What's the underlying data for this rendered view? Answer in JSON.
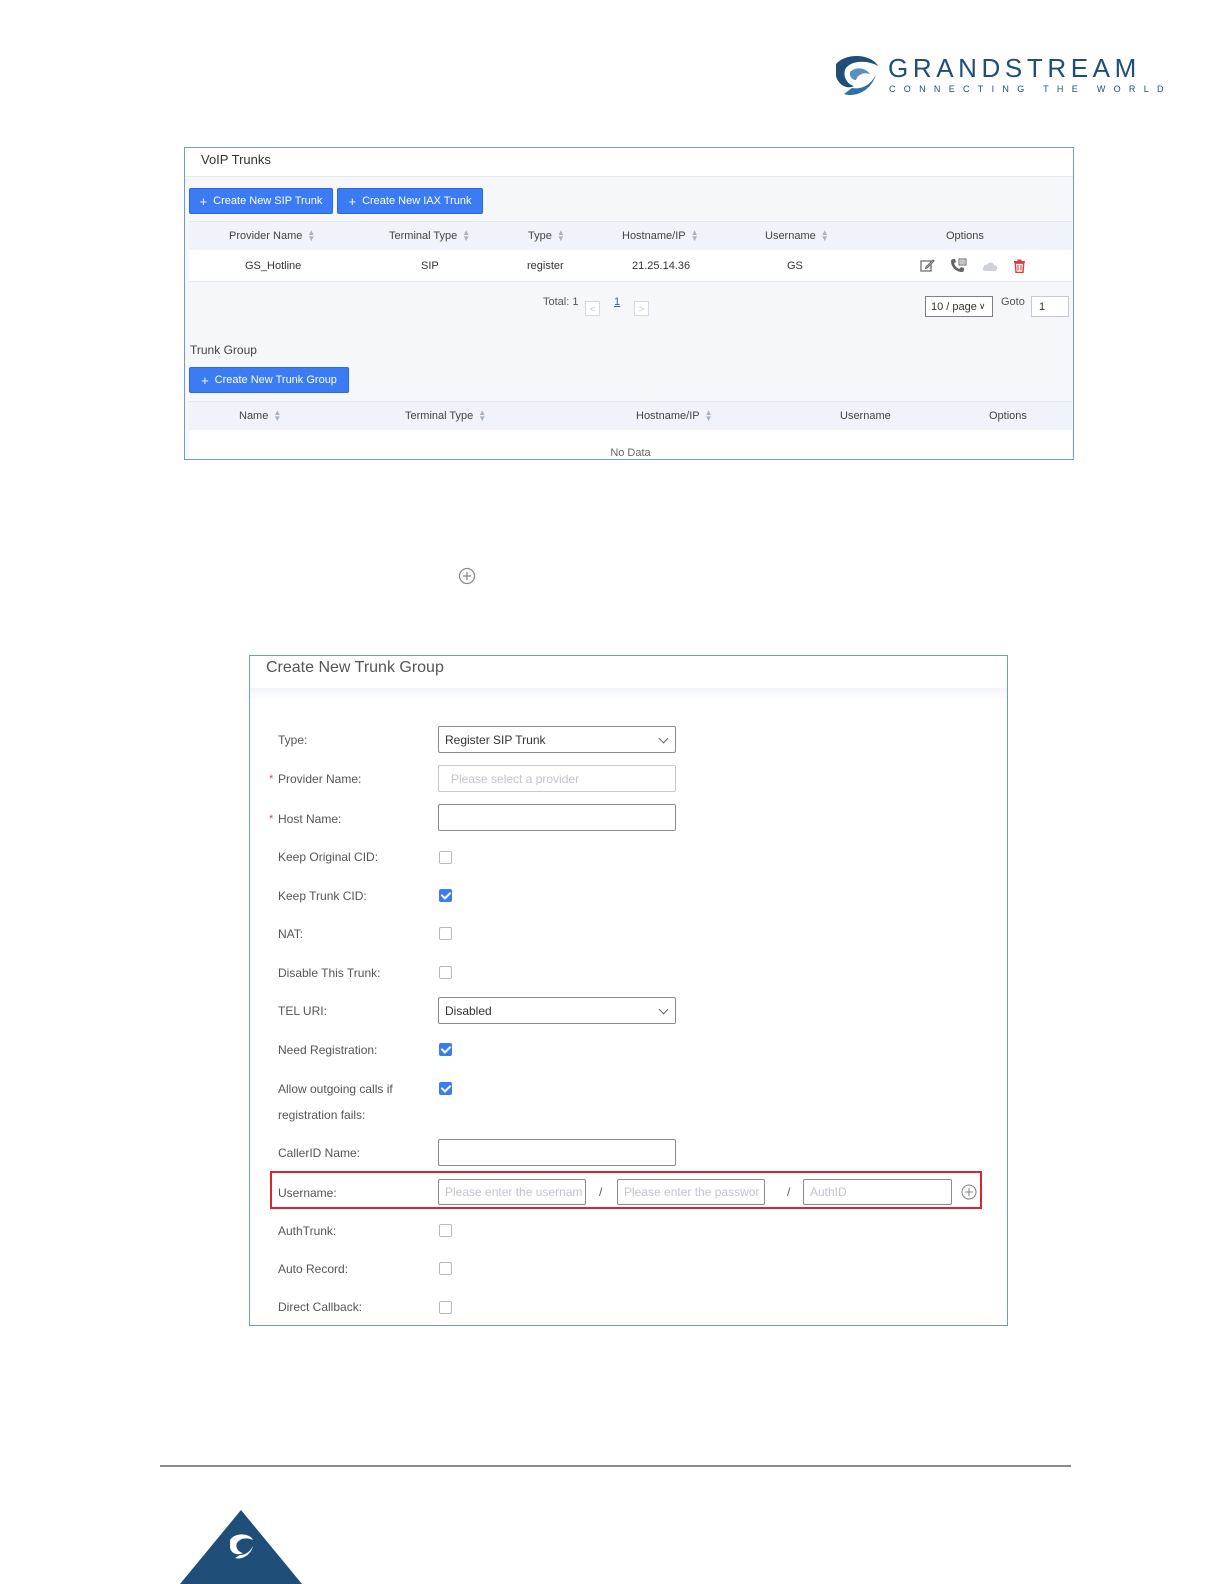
{
  "brand": {
    "name": "GRANDSTREAM",
    "tagline": "CONNECTING THE WORLD",
    "color": "#1f4e79"
  },
  "voip_trunks": {
    "title": "VoIP Trunks",
    "create_sip_label": "Create New SIP Trunk",
    "create_iax_label": "Create New IAX Trunk",
    "columns": [
      "Provider Name",
      "Terminal Type",
      "Type",
      "Hostname/IP",
      "Username",
      "Options"
    ],
    "rows": [
      {
        "provider": "GS_Hotline",
        "terminal": "SIP",
        "type": "register",
        "host": "21.25.14.36",
        "username": "GS"
      }
    ],
    "row_icons": [
      "edit-icon",
      "phone-settings-icon",
      "cloud-icon",
      "delete-icon"
    ],
    "pagination": {
      "total_label": "Total: 1",
      "page": "1",
      "page_size": "10 / page",
      "goto_label": "Goto",
      "goto_value": "1"
    }
  },
  "trunk_group": {
    "title": "Trunk Group",
    "create_label": "Create New Trunk Group",
    "columns": [
      "Name",
      "Terminal Type",
      "Hostname/IP",
      "Username",
      "Options"
    ],
    "empty_text": "No Data"
  },
  "form": {
    "title": "Create New Trunk Group",
    "fields": {
      "type_label": "Type:",
      "type_value": "Register SIP Trunk",
      "provider_label": "Provider Name:",
      "provider_placeholder": "Please select a provider",
      "host_label": "Host Name:",
      "keep_cid_label": "Keep Original CID:",
      "keep_trunk_cid_label": "Keep Trunk CID:",
      "nat_label": "NAT:",
      "disable_label": "Disable This Trunk:",
      "tel_uri_label": "TEL URI:",
      "tel_uri_value": "Disabled",
      "need_reg_label": "Need Registration:",
      "allow_out_label_1": "Allow outgoing calls if",
      "allow_out_label_2": "registration fails:",
      "callerid_label": "CallerID Name:",
      "username_label": "Username:",
      "username_placeholder": "Please enter the usernam",
      "password_placeholder": "Please enter the passwor",
      "authid_placeholder": "AuthID",
      "slash": "/",
      "authtrunk_label": "AuthTrunk:",
      "auto_record_label": "Auto Record:",
      "direct_callback_label": "Direct Callback:",
      "required_mark": "*"
    },
    "checked": {
      "keep_cid": false,
      "keep_trunk_cid": true,
      "nat": false,
      "disable": false,
      "need_reg": true,
      "allow_out": true,
      "authtrunk": false,
      "auto_record": false,
      "direct_callback": false
    }
  },
  "colors": {
    "primary": "#3b7cf5",
    "highlight_border": "#d9262e",
    "delete": "#e03a3a"
  }
}
